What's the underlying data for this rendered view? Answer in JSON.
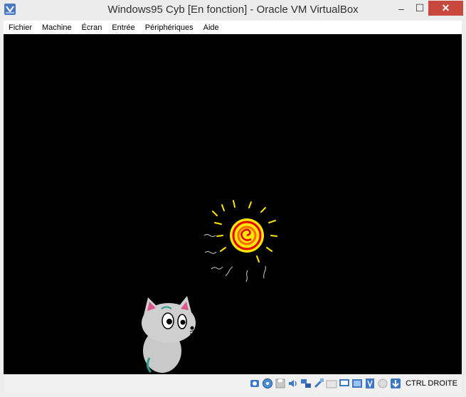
{
  "window": {
    "title": "Windows95 Cyb [En fonction] - Oracle VM VirtualBox",
    "minimize_symbol": "–",
    "maximize_symbol": "☐",
    "close_symbol": "✕"
  },
  "menu": {
    "items": [
      "Fichier",
      "Machine",
      "Écran",
      "Entrée",
      "Périphériques",
      "Aide"
    ]
  },
  "guest_screen": {
    "background": "#000000",
    "graphics": [
      "sun-drawing",
      "kitten-drawing"
    ]
  },
  "statusbar": {
    "icons": [
      "hard-disk-icon",
      "optical-drive-icon",
      "floppy-icon",
      "audio-icon",
      "network-icon",
      "usb-icon",
      "shared-folders-icon",
      "display-icon",
      "video-capture-icon",
      "virtualization-icon",
      "mouse-integration-icon",
      "host-key-arrow-icon"
    ],
    "host_key": "CTRL DROITE"
  },
  "colors": {
    "title_bg": "#ececec",
    "close_button": "#c7483c",
    "screen": "#000000",
    "sun_outer": "#ffe600",
    "sun_inner": "#e60000"
  }
}
